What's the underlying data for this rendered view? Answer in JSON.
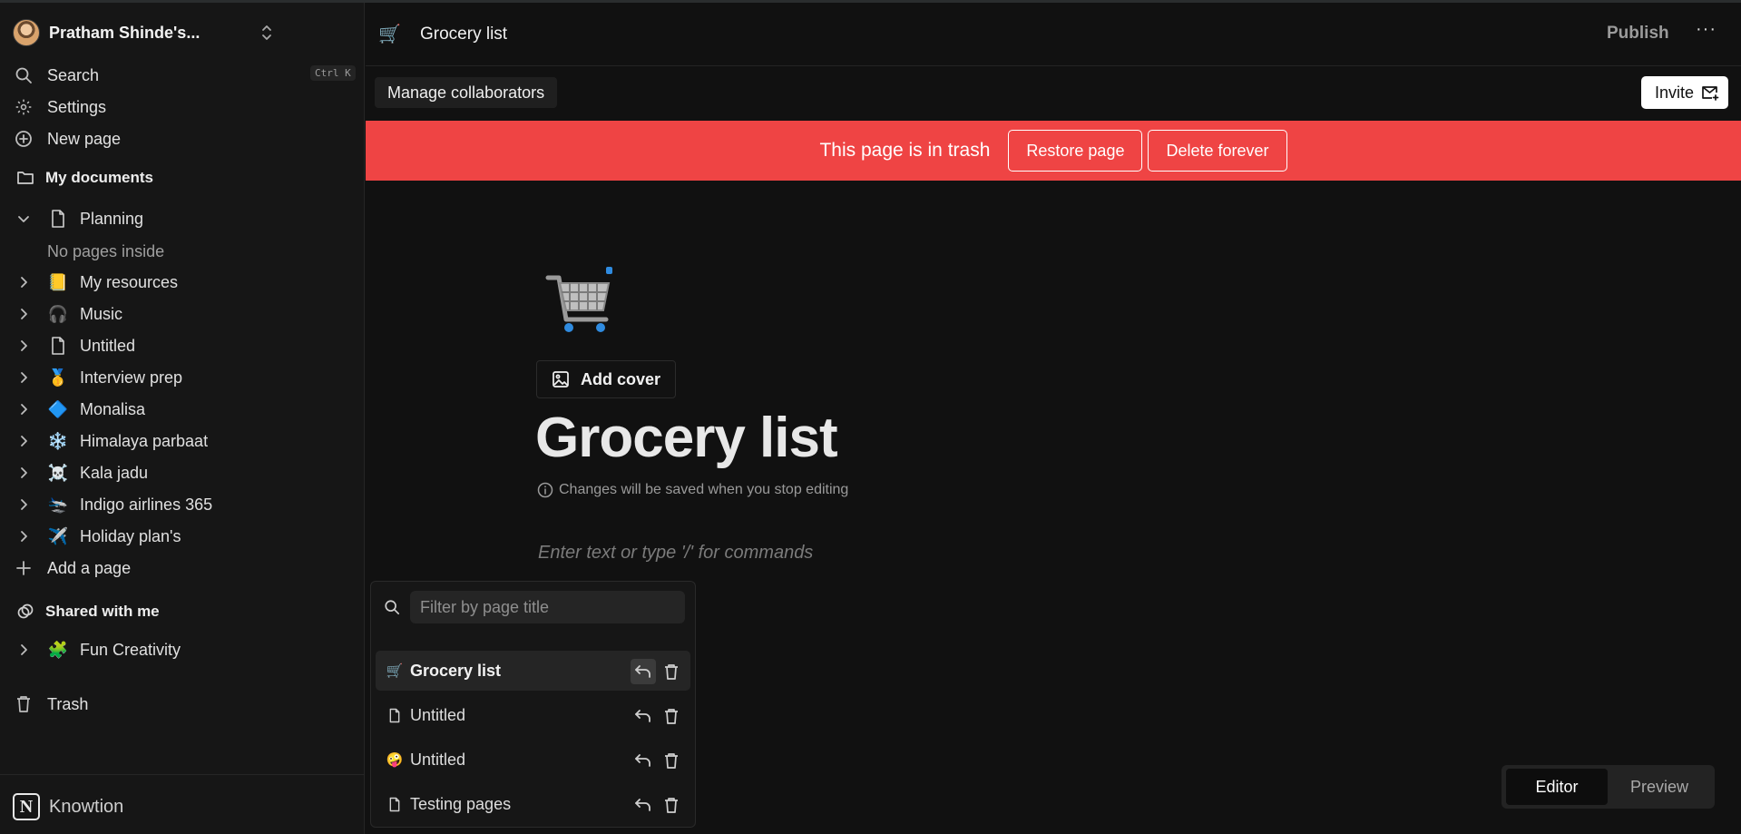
{
  "workspace": {
    "name": "Pratham Shinde's..."
  },
  "sidebar": {
    "search_label": "Search",
    "search_shortcut": "Ctrl K",
    "settings_label": "Settings",
    "new_page_label": "New page",
    "my_documents_label": "My documents",
    "planning_label": "Planning",
    "no_pages_text": "No pages inside",
    "pages": [
      {
        "icon": "📒",
        "label": "My resources"
      },
      {
        "icon": "🎧",
        "label": "Music"
      },
      {
        "icon": "📄",
        "label": "Untitled"
      },
      {
        "icon": "🥇",
        "label": "Interview prep"
      },
      {
        "icon": "🔷",
        "label": "Monalisa"
      },
      {
        "icon": "❄️",
        "label": "Himalaya parbaat"
      },
      {
        "icon": "☠️",
        "label": "Kala jadu"
      },
      {
        "icon": "🛬",
        "label": "Indigo airlines 365"
      },
      {
        "icon": "✈️",
        "label": "Holiday plan's"
      }
    ],
    "add_page_label": "Add a page",
    "shared_label": "Shared with me",
    "shared_pages": [
      {
        "icon": "🧩",
        "label": "Fun Creativity"
      }
    ],
    "trash_label": "Trash",
    "brand": "Knowtion"
  },
  "topbar": {
    "page_icon": "🛒",
    "page_title": "Grocery list",
    "publish_label": "Publish",
    "more_label": "···"
  },
  "toolbar": {
    "collaborators_label": "Manage collaborators",
    "invite_label": "Invite"
  },
  "trash_banner": {
    "message": "This page is in trash",
    "restore_label": "Restore page",
    "delete_label": "Delete forever"
  },
  "page": {
    "icon": "🛒",
    "add_cover_label": "Add cover",
    "title": "Grocery list",
    "save_note": "Changes will be saved when you stop editing",
    "editor_placeholder": "Enter text or type '/' for commands"
  },
  "trash_popup": {
    "filter_placeholder": "Filter by page title",
    "items": [
      {
        "icon": "🛒",
        "label": "Grocery list"
      },
      {
        "icon": "📄",
        "label": "Untitled"
      },
      {
        "icon": "🤪",
        "label": "Untitled"
      },
      {
        "icon": "📄",
        "label": "Testing pages"
      }
    ]
  },
  "mode": {
    "editor_label": "Editor",
    "preview_label": "Preview"
  }
}
